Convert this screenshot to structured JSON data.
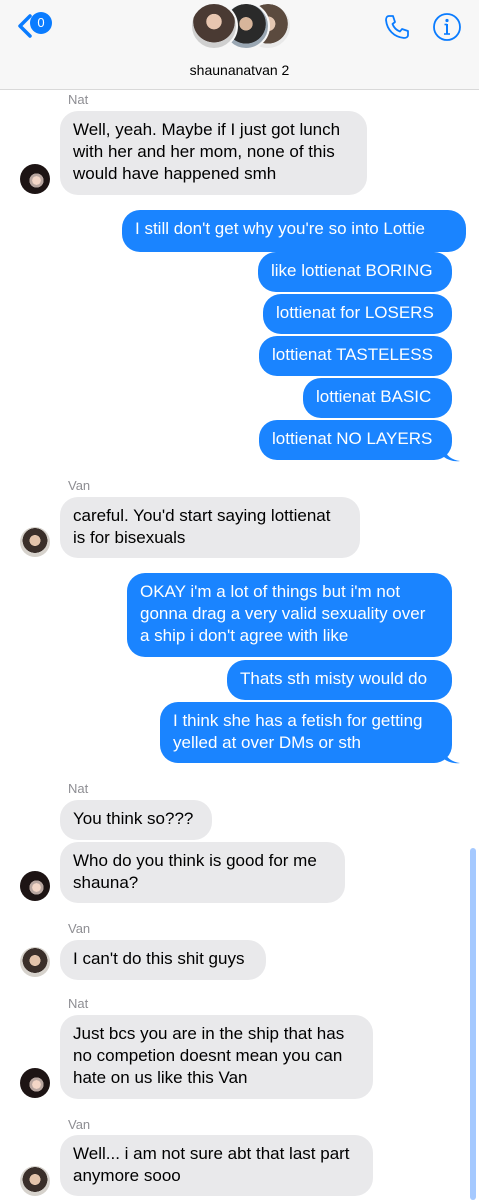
{
  "header": {
    "back_badge": "0",
    "title": "shaunanatvan 2"
  },
  "messages": {
    "s1": "Nat",
    "m1": "Well, yeah. Maybe if I just got lunch with her and her mom, none of this would have happened smh",
    "m2": "I still don't get why you're so into Lottie",
    "m3": "like lottienat BORING",
    "m4": "lottienat for LOSERS",
    "m5": "lottienat TASTELESS",
    "m6": "lottienat BASIC",
    "m7": "lottienat NO LAYERS",
    "s2": "Van",
    "m8": "careful. You'd start saying lottienat is for bisexuals",
    "m9": "OKAY i'm a lot of things but i'm not gonna drag a very valid sexuality over a ship i don't agree with like",
    "m10": "Thats sth misty would do",
    "m11": "I think she has a fetish for getting yelled at over DMs or sth",
    "s3": "Nat",
    "m12": "You think so???",
    "m13": "Who do you think is good for me shauna?",
    "s4": "Van",
    "m14": "I can't do this shit guys",
    "s5": "Nat",
    "m15": "Just bcs you are in the ship that has no competion doesnt mean you can hate on us like this Van",
    "s6": "Van",
    "m16": "Well... i am not sure abt that last part anymore sooo"
  },
  "colors": {
    "outgoing": "#1a84ff",
    "incoming": "#e9e9eb",
    "accent": "#0a7cff"
  },
  "icons": [
    "back-chevron-icon",
    "phone-icon",
    "info-icon"
  ]
}
